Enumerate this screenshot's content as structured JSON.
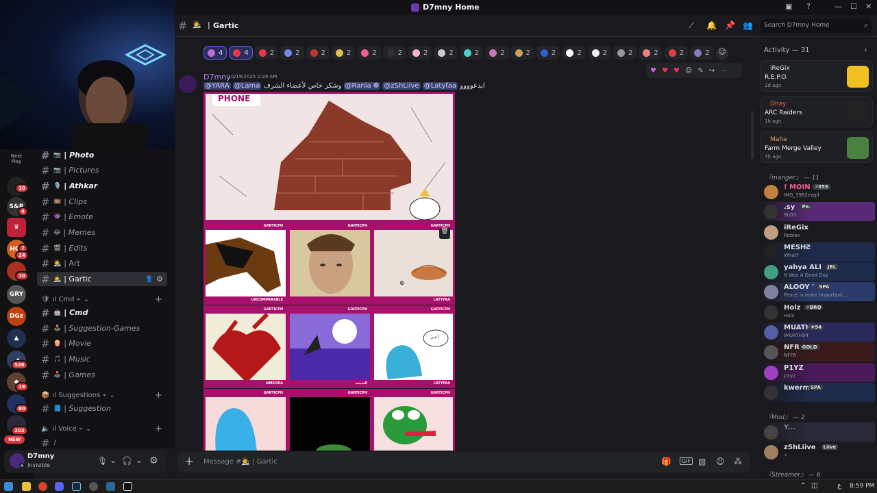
{
  "window": {
    "title": "D7mny Home"
  },
  "header": {
    "channel_emoji": "🧑‍🎨",
    "channel_name": "Gartic",
    "search_placeholder": "Search D7mny Home"
  },
  "guild_rail": {
    "next_play": "Next\nPlay",
    "badges": [
      "10",
      "4",
      "7",
      "24",
      "10",
      "526",
      "19",
      "80",
      "203"
    ],
    "new_badge": "NEW",
    "labels": [
      "S&R",
      "HO!",
      "GRY",
      "DGz"
    ]
  },
  "channels": [
    {
      "emoji": "📷",
      "name": "| Photo",
      "style": "bright"
    },
    {
      "emoji": "📷",
      "name": "| Pictures",
      "style": "dim"
    },
    {
      "emoji": "🎙️",
      "name": "| Athkar",
      "style": "bright"
    },
    {
      "emoji": "🎞️",
      "name": "| Clips",
      "style": "dim"
    },
    {
      "emoji": "👾",
      "name": "| Emote",
      "style": "dim"
    },
    {
      "emoji": "😂",
      "name": "| Memes",
      "style": "dim"
    },
    {
      "emoji": "🎬",
      "name": "| Edits",
      "style": "dim"
    },
    {
      "emoji": "🧑‍🎨",
      "name": "| Art",
      "style": "dim"
    },
    {
      "emoji": "🧑‍🎨",
      "name": "| Gartic",
      "style": "active"
    }
  ],
  "cmd_category": {
    "label": "ıl Cmd ⌁",
    "channels": [
      {
        "emoji": "🤖",
        "name": "| Cmd",
        "style": "bright"
      },
      {
        "emoji": "🕹️",
        "name": "| Suggestion-Games",
        "style": "dim"
      },
      {
        "emoji": "🍿",
        "name": "| Movie",
        "style": "dim"
      },
      {
        "emoji": "🎵",
        "name": "| Music",
        "style": "dim"
      },
      {
        "emoji": "🕹️",
        "name": "| Games",
        "style": "dim"
      }
    ]
  },
  "suggestions_category": {
    "label": "ıl Suggestions ⌁",
    "channels": [
      {
        "emoji": "📘",
        "name": "| Suggestion",
        "style": "dim"
      }
    ]
  },
  "voice_category": {
    "label": "ıl Voice ⌁"
  },
  "user_panel": {
    "name": "D7mny",
    "status": "Invisible"
  },
  "reactions": [
    {
      "count": "4",
      "me": true,
      "color": "#c46ad6"
    },
    {
      "count": "4",
      "me": true,
      "color": "#e8364a"
    },
    {
      "count": "2",
      "color": "#e8364a"
    },
    {
      "count": "2",
      "color": "#6b8cf0"
    },
    {
      "count": "2",
      "color": "#c0392b"
    },
    {
      "count": "2",
      "color": "#e0c050"
    },
    {
      "count": "2",
      "color": "#f06090"
    },
    {
      "count": "2",
      "color": "#333333"
    },
    {
      "count": "2",
      "color": "#f4b6c8"
    },
    {
      "count": "2",
      "color": "#cccccc"
    },
    {
      "count": "2",
      "color": "#4fd0d0"
    },
    {
      "count": "2",
      "color": "#d070c0"
    },
    {
      "count": "2",
      "color": "#d0a060"
    },
    {
      "count": "2",
      "color": "#3060d0"
    },
    {
      "count": "2",
      "color": "#ffffff"
    },
    {
      "count": "2",
      "color": "#eeeeee"
    },
    {
      "count": "2",
      "color": "#999999"
    },
    {
      "count": "2",
      "color": "#f08080"
    },
    {
      "count": "2",
      "color": "#e04040"
    },
    {
      "count": "2",
      "color": "#8a7ac0"
    }
  ],
  "message": {
    "author": "D7mny",
    "timestamp": "10/19/2025 2:28 AM",
    "text_rtl": "ابدعوووو",
    "mentions": [
      "@Latyfaa",
      "@zShLiive",
      "@Rania ❁"
    ],
    "text_mid": "وشكر خاص لأعضاء الشرف",
    "mentions_end": [
      "@Lama",
      "@YARA"
    ]
  },
  "gartic": {
    "logo": "PHONE",
    "captions": [
      "UNCOMPARABLE",
      "",
      "LATYFAA",
      "NMSORA",
      "الشيخه",
      "LATYFAA",
      "",
      "",
      ""
    ],
    "brand": "GARTICPH",
    "speech": "أحبي"
  },
  "composer": {
    "placeholder": "Message #🧑‍🎨 | Gartic"
  },
  "activity": {
    "header": "Activity — 31",
    "cards": [
      {
        "user": "iReGix",
        "game": "R.E.P.O.",
        "ago": "2d ago",
        "user_color": "#dbdee1",
        "art": "#f0c020"
      },
      {
        "user": "Dhay",
        "game": "ARC Raiders",
        "ago": "1h ago",
        "user_color": "#f06040",
        "art": "#222"
      },
      {
        "user": "Maha",
        "game": "Farm Merge Valley",
        "ago": "7h ago",
        "user_color": "#e8a060",
        "art": "#4a8040"
      }
    ]
  },
  "member_sections": [
    {
      "label": "『manger』 — 11"
    },
    {
      "label": "『Mod』 — 2"
    },
    {
      "label": "『Streamer』 — 6"
    }
  ],
  "members": [
    {
      "name": "! MOIN",
      "tag": "⚡555",
      "status": "IMG_3962ezgif",
      "color": "#f06090",
      "bg": "",
      "av": "#c08040"
    },
    {
      "name": ".sy",
      "tag": "Pe.",
      "status": "9LO3",
      "color": "#dbdee1",
      "bg": "#5a2a7a",
      "av": "#333"
    },
    {
      "name": "iReGix",
      "tag": "",
      "status": "Roblox",
      "color": "#dbdee1",
      "bg": "",
      "av": "#c0a080"
    },
    {
      "name": "MESHƧ",
      "tag": "",
      "status": "What?",
      "color": "#dbdee1",
      "bg": "#1e2a4a",
      "av": "#222"
    },
    {
      "name": "yahya ALI",
      "tag": "JBL",
      "status": "It Was A Good Day",
      "color": "#dbdee1",
      "bg": "#1e2a4a",
      "av": "#40a080"
    },
    {
      "name": "ALOOY '",
      "tag": "SPA",
      "status": "Peace is more important...",
      "color": "#dbdee1",
      "bg": "#2a3a6a",
      "av": "#8080a0"
    },
    {
      "name": "Holz",
      "tag": "⚡BRQ",
      "status": "Holz",
      "color": "#dbdee1",
      "bg": "",
      "av": "#333"
    },
    {
      "name": "MUATH",
      "tag": "❖94",
      "status": "iMUATH94",
      "color": "#dbdee1",
      "bg": "#2a2a5a",
      "av": "#5060a0"
    },
    {
      "name": "NFR",
      "tag": "GOLD",
      "status": "NFFR",
      "color": "#dbdee1",
      "bg": "#3a1a1a",
      "av": "#555"
    },
    {
      "name": "P1YZ",
      "tag": "",
      "status": "p1yz",
      "color": "#dbdee1",
      "bg": "#4a1a5a",
      "av": "#a040c0"
    },
    {
      "name": "kwerm",
      "tag": "SPA",
      "status": "",
      "color": "#dbdee1",
      "bg": "#1e2a4a",
      "av": "#333"
    },
    {
      "name": "Y...",
      "tag": "",
      "status": "",
      "color": "#80848e",
      "bg": "#2a2a3a",
      "av": "#444"
    },
    {
      "name": "zShLiive",
      "tag": "Liive",
      "status": "⚡",
      "color": "#dbdee1",
      "bg": "",
      "av": "#a08060"
    }
  ],
  "taskbar": {
    "lang": "ع",
    "time": "8:59 PM"
  }
}
